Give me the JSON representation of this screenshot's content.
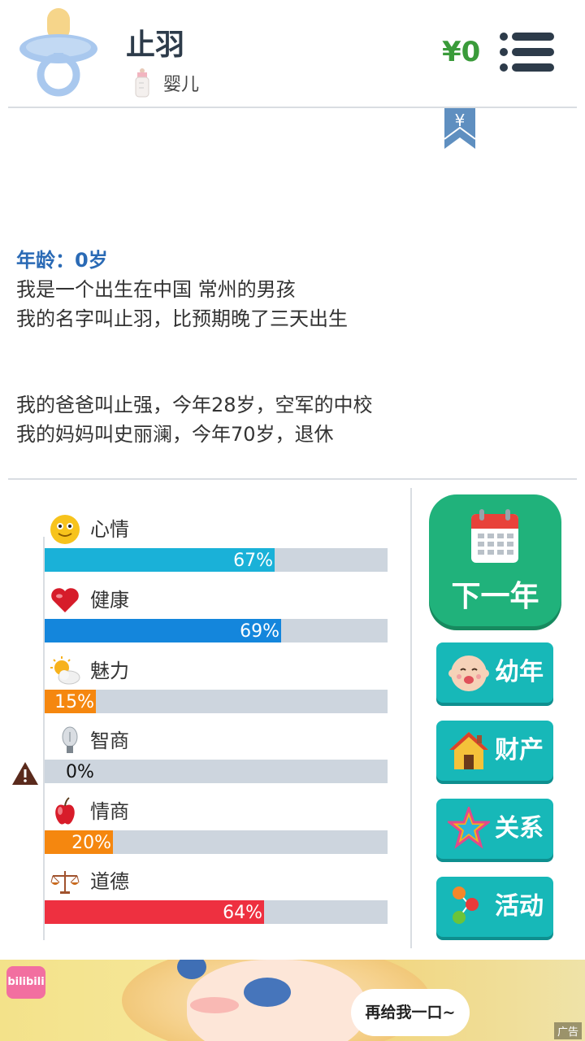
{
  "header": {
    "name": "止羽",
    "stage": "婴儿",
    "money": "¥0",
    "bookmark_symbol": "¥"
  },
  "story": {
    "age": "年龄：0岁",
    "lines_1": [
      "我是一个出生在中国 常州的男孩",
      "我的名字叫止羽，比预期晚了三天出生"
    ],
    "lines_2": [
      "我的爸爸叫止强，今年28岁，空军的中校",
      "我的妈妈叫史丽澜，今年70岁，退休"
    ]
  },
  "stats": [
    {
      "label": "心情",
      "percent": 67,
      "display": "67%",
      "icon": "smiley-icon",
      "color": "#1ab1d8"
    },
    {
      "label": "健康",
      "percent": 69,
      "display": "69%",
      "icon": "heart-icon",
      "color": "#1486dc"
    },
    {
      "label": "魅力",
      "percent": 15,
      "display": "15%",
      "icon": "sun-cloud-icon",
      "color": "#f5870f"
    },
    {
      "label": "智商",
      "percent": 0,
      "display": "0%",
      "icon": "lightbulb-icon",
      "color": "#f5870f"
    },
    {
      "label": "情商",
      "percent": 20,
      "display": "20%",
      "icon": "apple-icon",
      "color": "#f5870f"
    },
    {
      "label": "道德",
      "percent": 64,
      "display": "64%",
      "icon": "scales-icon",
      "color": "#ee3040"
    }
  ],
  "buttons": {
    "next_year": "下一年",
    "childhood": "幼年",
    "assets": "财产",
    "relations": "关系",
    "activities": "活动"
  },
  "ad": {
    "logo": "bilibili",
    "bubble": "再给我一口~",
    "tag": "广告"
  },
  "colors": {
    "accent_green": "#20b27b",
    "side_button": "#17b8b8",
    "money_green": "#3a9b3a"
  }
}
